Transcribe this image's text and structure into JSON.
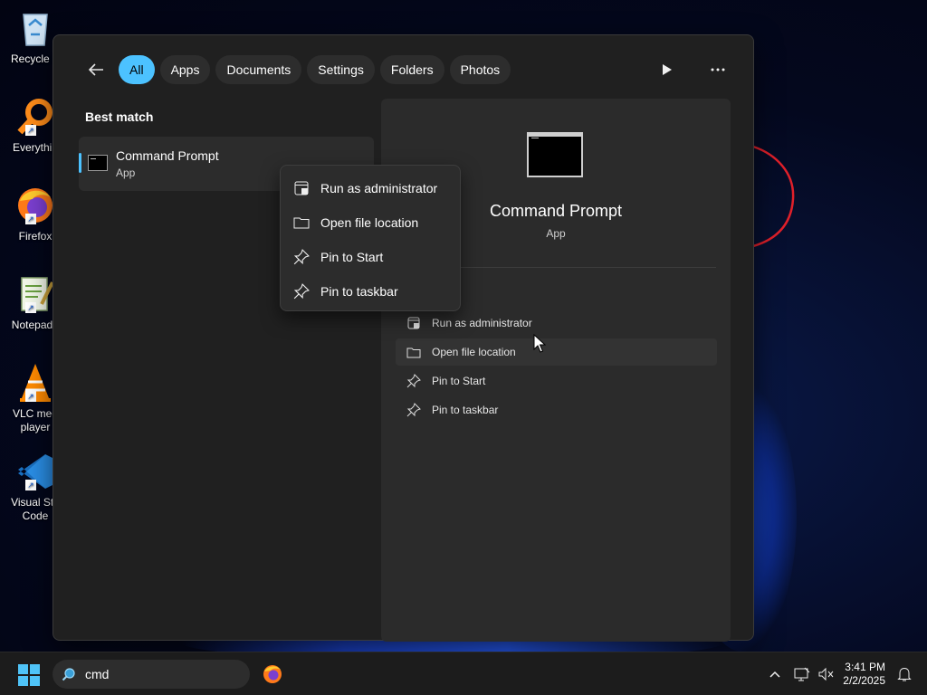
{
  "desktop": {
    "icons": [
      {
        "label": "Recycle B",
        "icon": "recycle-bin-icon"
      },
      {
        "label": "Everythin",
        "icon": "everything-search-icon"
      },
      {
        "label": "Firefox",
        "icon": "firefox-icon"
      },
      {
        "label": "Notepad+",
        "icon": "notepad-plus-plus-icon"
      },
      {
        "label": "VLC med",
        "label2": "player",
        "icon": "vlc-icon"
      },
      {
        "label": "Visual Stu",
        "label2": "Code",
        "icon": "vscode-icon"
      }
    ]
  },
  "search_panel": {
    "filters": [
      "All",
      "Apps",
      "Documents",
      "Settings",
      "Folders",
      "Photos"
    ],
    "active_filter": "All",
    "best_match_label": "Best match",
    "result": {
      "title": "Command Prompt",
      "subtitle": "App"
    },
    "details": {
      "title": "Command Prompt",
      "subtitle": "App",
      "actions": [
        "Run as administrator",
        "Open file location",
        "Pin to Start",
        "Pin to taskbar"
      ]
    }
  },
  "context_menu": {
    "items": [
      "Run as administrator",
      "Open file location",
      "Pin to Start",
      "Pin to taskbar"
    ]
  },
  "taskbar": {
    "search_value": "cmd",
    "time": "3:41 PM",
    "date": "2/2/2025"
  },
  "colors": {
    "accent": "#4cc2ff",
    "panel_bg": "#202020",
    "details_bg": "#2b2b2b",
    "annotation": "#e0202a"
  }
}
